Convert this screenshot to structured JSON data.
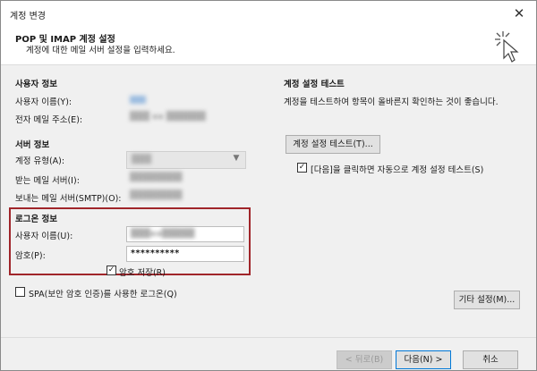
{
  "window": {
    "title": "계정 변경",
    "close_glyph": "✕"
  },
  "header": {
    "title": "POP 및 IMAP 계정 설정",
    "subtitle": "계정에 대한 메일 서버 설정을 입력하세요."
  },
  "user_info": {
    "section": "사용자 정보",
    "name_label": "사용자 이름(Y):",
    "email_label": "전자 메일 주소(E):"
  },
  "server_info": {
    "section": "서버 정보",
    "account_type_label": "계정 유형(A):",
    "incoming_label": "받는 메일 서버(I):",
    "outgoing_label": "보내는 메일 서버(SMTP)(O):"
  },
  "login_info": {
    "section": "로그온 정보",
    "username_label": "사용자 이름(U):",
    "password_label": "암호(P):",
    "password_value": "**********",
    "remember_password_label": "암호 저장(R)",
    "remember_checked_glyph": "✓"
  },
  "spa": {
    "label": "SPA(보안 암호 인증)를 사용한 로그온(Q)"
  },
  "test": {
    "section": "계정 설정 테스트",
    "description": "계정을 테스트하여 항목이 올바른지 확인하는 것이 좋습니다.",
    "test_button": "계정 설정 테스트(T)...",
    "auto_test_label": "[다음]을 클릭하면 자동으로 계정 설정 테스트(S)",
    "auto_test_checked_glyph": "✓"
  },
  "buttons": {
    "more_settings": "기타 설정(M)...",
    "back": "< 뒤로(B)",
    "next": "다음(N) >",
    "cancel": "취소"
  }
}
